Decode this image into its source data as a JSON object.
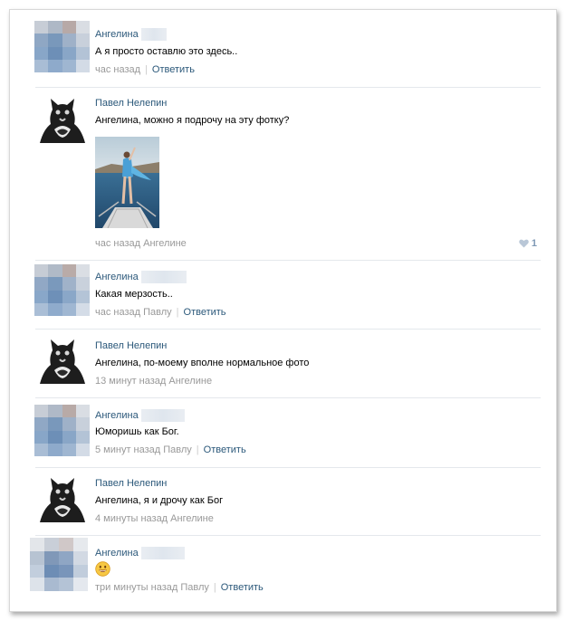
{
  "comments": [
    {
      "author": "Ангелина",
      "text": "А я просто оставлю это здесь..",
      "time": "час назад",
      "reply_label": "Ответить"
    },
    {
      "author": "Павел Нелепин",
      "text": "Ангелина, можно я подрочу на эту фотку?",
      "time": "час назад Ангелине",
      "likes": "1"
    },
    {
      "author": "Ангелина",
      "text": "Какая мерзость..",
      "time": "час назад Павлу",
      "reply_label": "Ответить"
    },
    {
      "author": "Павел Нелепин",
      "text": "Ангелина, по-моему вполне нормальное фото",
      "time": "13 минут назад Ангелине"
    },
    {
      "author": "Ангелина",
      "text": "Юморишь как Бог.",
      "time": "5 минут назад Павлу",
      "reply_label": "Ответить"
    },
    {
      "author": "Павел Нелепин",
      "text": "Ангелина, я и дрочу как Бог",
      "time": "4 минуты назад Ангелине"
    },
    {
      "author": "Ангелина",
      "text": "",
      "emoji": "smiley",
      "time": "три минуты назад Павлу",
      "reply_label": "Ответить"
    }
  ],
  "colors": {
    "link": "#2b587a",
    "meta": "#999999",
    "separator": "#e4e8ec",
    "like": "#7f99b5"
  }
}
